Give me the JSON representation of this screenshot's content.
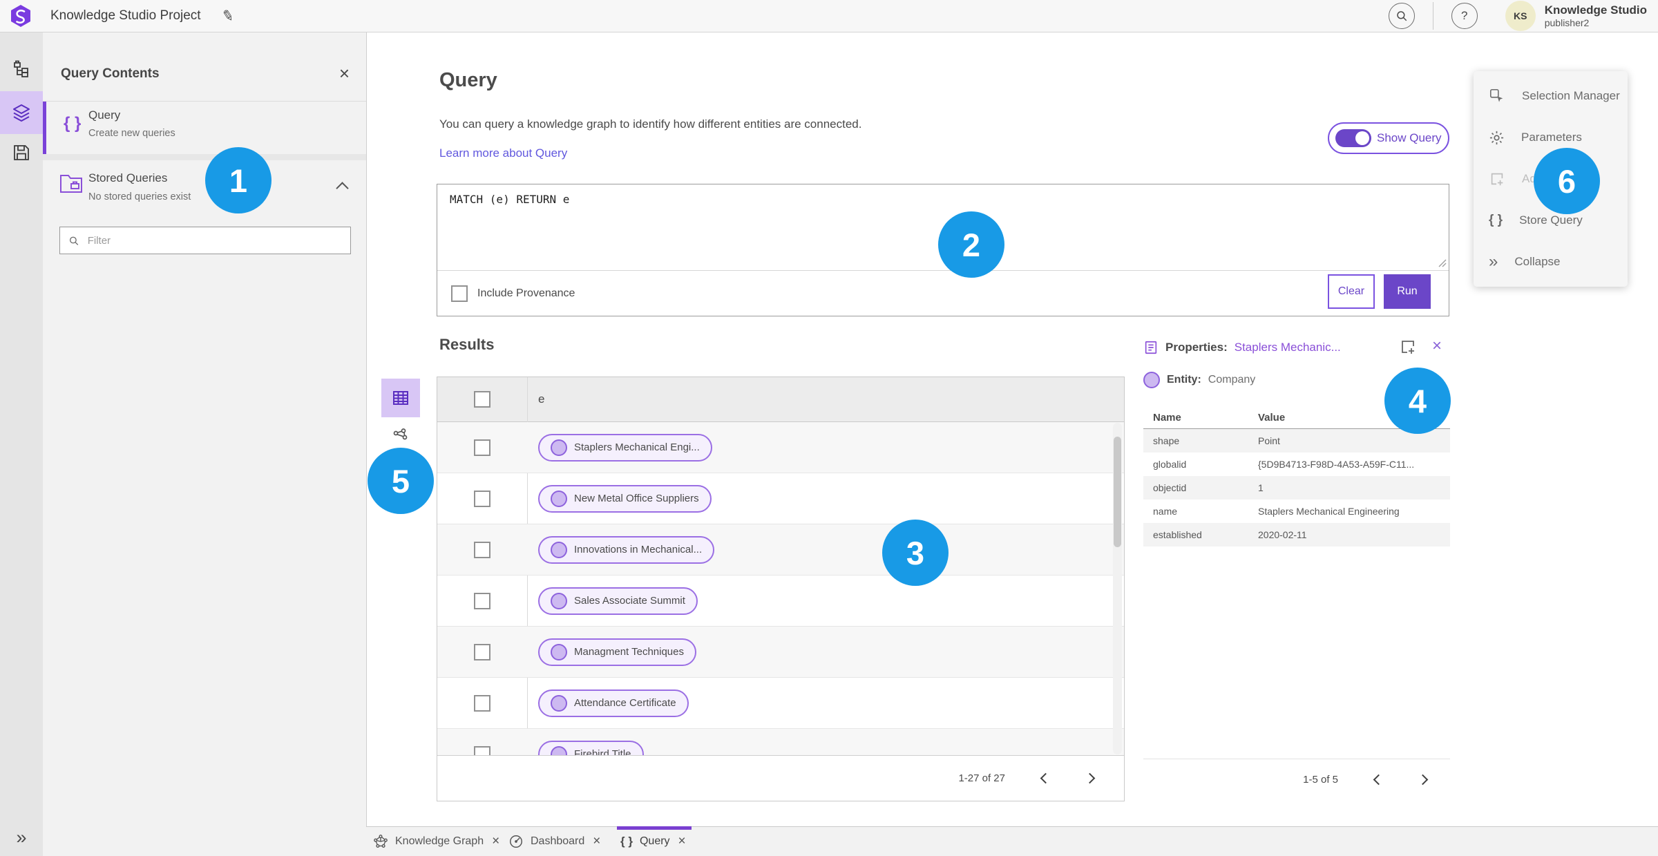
{
  "header": {
    "app_title": "Knowledge Studio Project",
    "user_name": "Knowledge Studio",
    "user_role": "publisher2",
    "avatar_initials": "KS"
  },
  "icons": {
    "close": "×",
    "edit": "✎",
    "help": "?",
    "braces": "{ }",
    "collapse": "»",
    "expand": "»"
  },
  "contents_panel": {
    "title": "Query Contents",
    "query_item": {
      "label": "Query",
      "description": "Create new queries"
    },
    "stored_item": {
      "label": "Stored Queries",
      "description": "No stored queries exist"
    },
    "filter_placeholder": "Filter"
  },
  "query_section": {
    "title": "Query",
    "description": "You can query a knowledge graph to identify how different entities are connected.",
    "learn_more": "Learn more about Query",
    "show_query_label": "Show Query",
    "query_text": "MATCH (e) RETURN e",
    "include_provenance_label": "Include Provenance",
    "clear_label": "Clear",
    "run_label": "Run"
  },
  "results": {
    "title": "Results",
    "column_header": "e",
    "rows": [
      "Staplers Mechanical Engi...",
      "New Metal Office Suppliers",
      "Innovations in Mechanical...",
      "Sales Associate Summit",
      "Managment Techniques",
      "Attendance Certificate",
      "Firebird Title"
    ],
    "pagination": "1-27 of 27"
  },
  "properties_panel": {
    "title_label": "Properties:",
    "title_link": "Staplers Mechanic...",
    "entity_label": "Entity:",
    "entity_value": "Company",
    "col_name": "Name",
    "col_value": "Value",
    "rows": [
      {
        "name": "shape",
        "value": "Point"
      },
      {
        "name": "globalid",
        "value": "{5D9B4713-F98D-4A53-A59F-C11..."
      },
      {
        "name": "objectid",
        "value": "1"
      },
      {
        "name": "name",
        "value": "Staplers Mechanical Engineering"
      },
      {
        "name": "established",
        "value": "2020-02-11"
      }
    ],
    "pagination": "1-5 of 5"
  },
  "tools_menu": {
    "items": [
      {
        "label": "Selection Manager"
      },
      {
        "label": "Parameters"
      },
      {
        "label": "Add"
      },
      {
        "label": "Store Query"
      },
      {
        "label": "Collapse"
      }
    ]
  },
  "bottom_tabs": [
    {
      "label": "Knowledge Graph"
    },
    {
      "label": "Dashboard"
    },
    {
      "label": "Query"
    }
  ],
  "annotations": [
    "1",
    "2",
    "3",
    "4",
    "5",
    "6"
  ],
  "colors": {
    "accent_purple": "#6b46c8",
    "icon_purple": "#8a4fd8",
    "link_blue": "#6158de",
    "annotation_blue": "#189ae6",
    "pill_border": "#9b6fe4",
    "pill_bg": "#f5f0fd"
  }
}
